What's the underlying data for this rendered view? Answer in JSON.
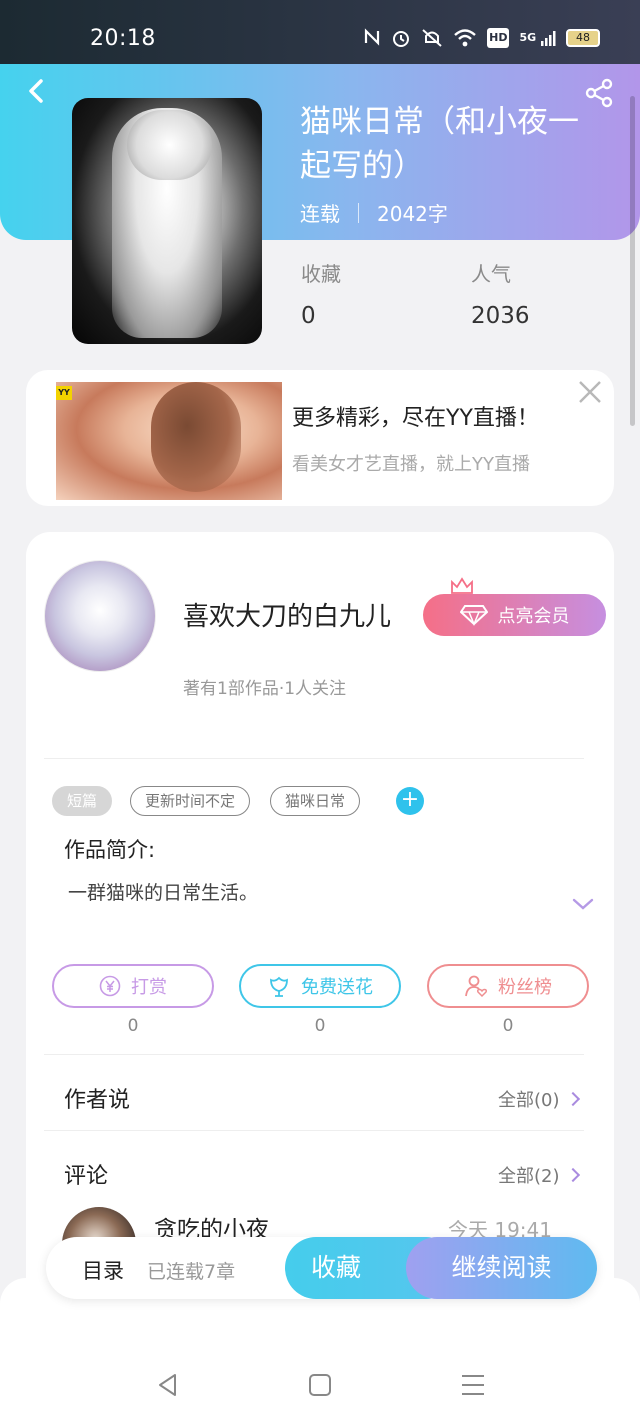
{
  "status_bar": {
    "time": "20:18",
    "icons": [
      "nfc-icon",
      "alarm-icon",
      "mute-icon",
      "wifi-icon",
      "hd-icon",
      "signal-5g-icon"
    ],
    "hd": "HD",
    "net": "5G",
    "battery": "48"
  },
  "book": {
    "title": "猫咪日常（和小夜一起写的）",
    "status": "连载",
    "word_count": "2042字",
    "stats": [
      {
        "label": "收藏",
        "value": "0"
      },
      {
        "label": "人气",
        "value": "2036"
      }
    ]
  },
  "ad": {
    "badge": "YY",
    "title": "更多精彩，尽在YY直播！",
    "subtitle": "看美女才艺直播，就上YY直播"
  },
  "author": {
    "name": "喜欢大刀的白九儿",
    "vip_label": "点亮会员",
    "subline": "著有1部作品·1人关注"
  },
  "tags": [
    "短篇",
    "更新时间不定",
    "猫咪日常"
  ],
  "add_tag": "+",
  "intro": {
    "label": "作品简介:",
    "text": "一群猫咪的日常生活。"
  },
  "actions": [
    {
      "label": "打赏",
      "count": "0",
      "color": "#c79ae6"
    },
    {
      "label": "免费送花",
      "count": "0",
      "color": "#3fc6e8"
    },
    {
      "label": "粉丝榜",
      "count": "0",
      "color": "#ef8e90"
    }
  ],
  "author_says": {
    "title": "作者说",
    "link": "全部(0)"
  },
  "comments": {
    "title": "评论",
    "link": "全部(2)",
    "first": {
      "name": "贪吃的小夜",
      "time": "今天 19:41"
    }
  },
  "bottom_bar": {
    "toc": "目录",
    "toc_sub": "已连载7章",
    "favorite": "收藏",
    "continue": "继续阅读"
  },
  "colors": {
    "accent_cyan": "#45cdec",
    "accent_purple": "#b296ea",
    "vip_pink": "#f56f87"
  }
}
